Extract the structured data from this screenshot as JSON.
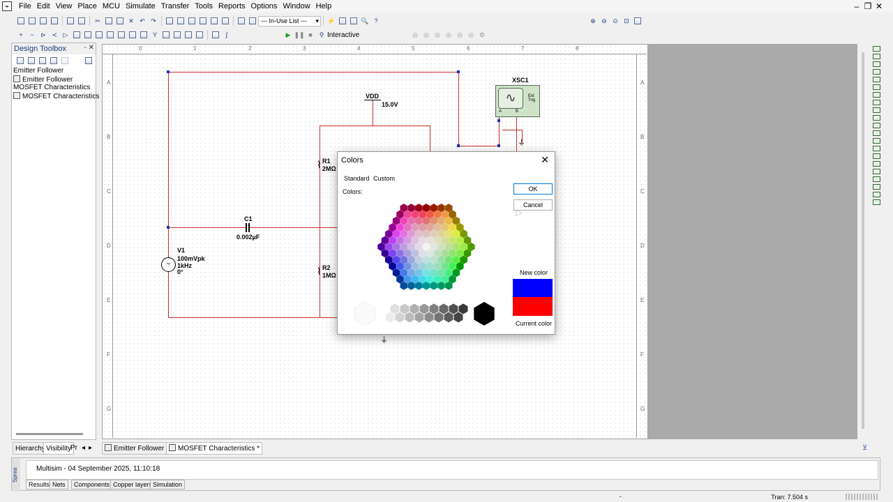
{
  "menubar": {
    "items": [
      "File",
      "Edit",
      "View",
      "Place",
      "MCU",
      "Simulate",
      "Transfer",
      "Tools",
      "Reports",
      "Options",
      "Window",
      "Help"
    ]
  },
  "toolbar": {
    "inuse_list": "--- In-Use List ---",
    "interactive_label": "Interactive"
  },
  "toolbox": {
    "title": "Design Toolbox",
    "items": [
      "Emitter Follower",
      "Emitter Follower",
      "MOSFET Characteristics",
      "MOSFET Characteristics"
    ]
  },
  "ruler": {
    "top": [
      "0",
      "1",
      "2",
      "3",
      "4",
      "5",
      "6",
      "7",
      "8"
    ],
    "side": [
      "A",
      "B",
      "C",
      "D",
      "E",
      "F",
      "G"
    ]
  },
  "circuit": {
    "vdd_name": "VDD",
    "vdd_value": "15.0V",
    "r1_name": "R1",
    "r1_value": "2MΩ",
    "r2_name": "R2",
    "r2_value": "1MΩ",
    "c1_name": "C1",
    "c1_value": "0.002µF",
    "v1_name": "V1",
    "v1_amp": "100mVpk",
    "v1_freq": "1kHz",
    "v1_phase": "0°",
    "scope_name": "XSC1",
    "scope_trig": "Ext Trig",
    "scope_a": "A",
    "scope_b": "B"
  },
  "dialog": {
    "title": "Colors",
    "tab_standard": "Standard",
    "tab_custom": "Custom",
    "colors_label": "Colors:",
    "ok": "OK",
    "cancel": "Cancel",
    "new_color": "New color",
    "current_color": "Current color",
    "new_color_hex": "#0000ff",
    "current_color_hex": "#ff0000"
  },
  "bottom_tabs": {
    "hierarchy": "Hierarchy",
    "visibility": "Visibility",
    "pr": "Pr",
    "doc1": "Emitter Follower",
    "doc2": "MOSFET Characteristics *"
  },
  "spreadsheet": {
    "side_label": "Sprea",
    "log_text": "Multisim  -  04 September 2025, 11:10:18",
    "tabs": [
      "Results",
      "Nets",
      "Components",
      "Copper layers",
      "Simulation"
    ]
  },
  "status": {
    "dash": "-",
    "tran": "Tran: 7.504 s"
  }
}
